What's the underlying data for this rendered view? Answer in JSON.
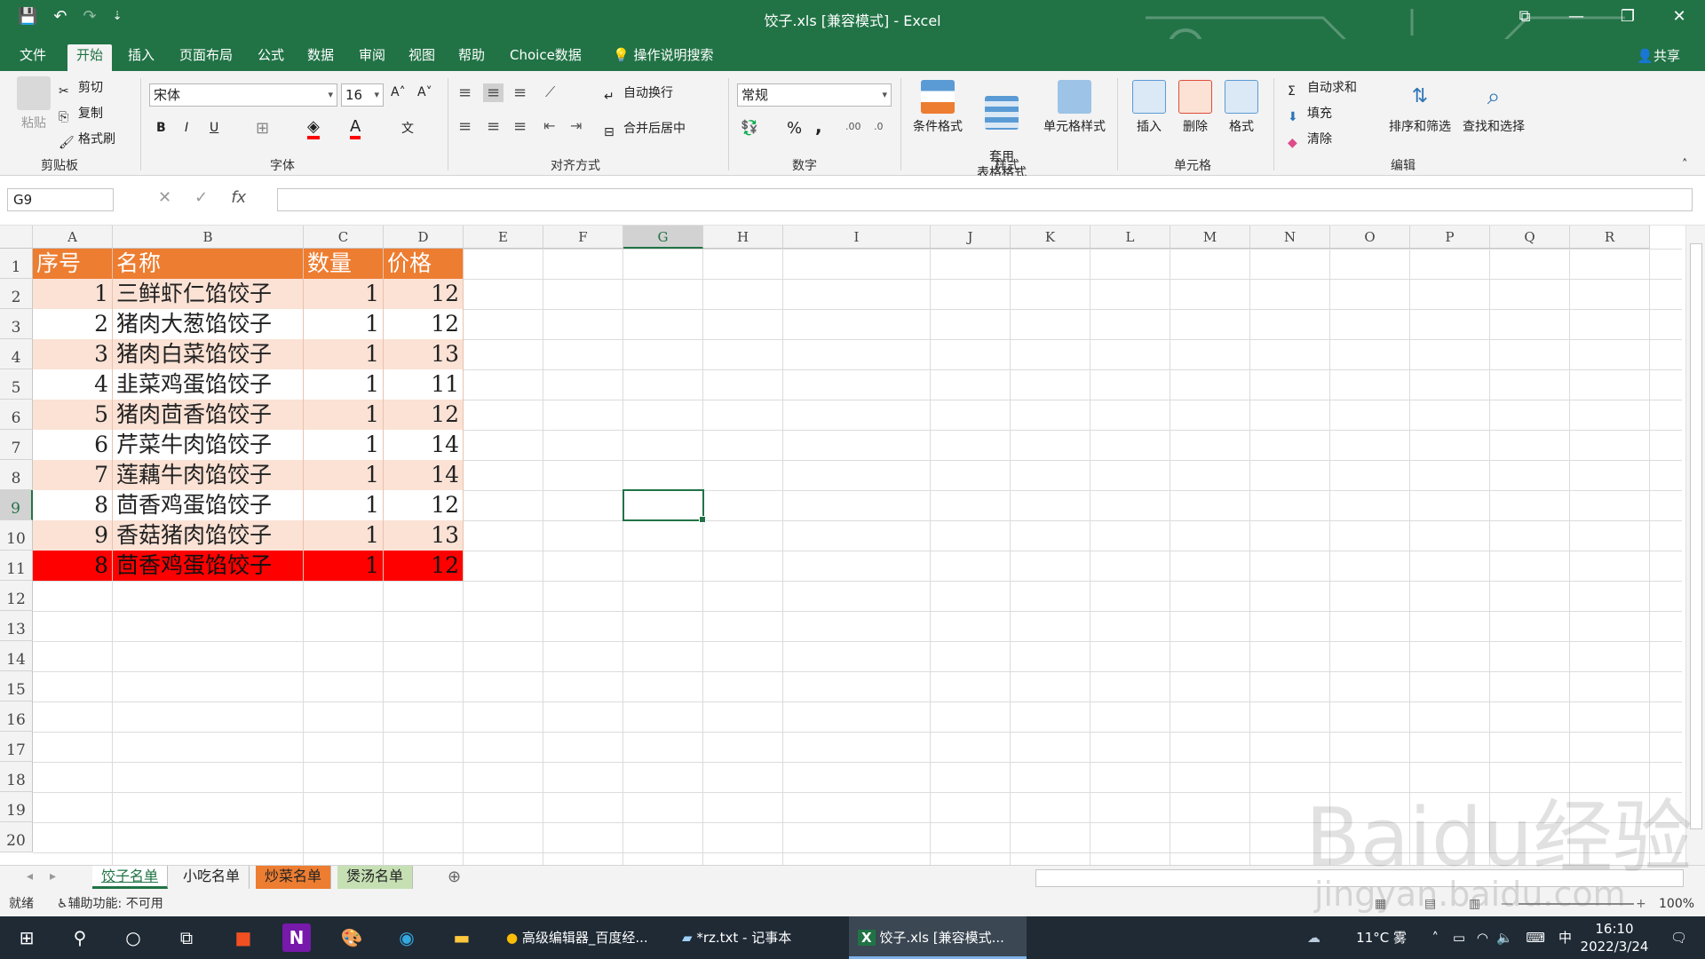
{
  "title": "饺子.xls [兼容模式] - Excel",
  "qat": {
    "save": "💾",
    "undo": "↶",
    "redo": "↷",
    "more": "⇣"
  },
  "tabs": [
    "文件",
    "开始",
    "插入",
    "页面布局",
    "公式",
    "数据",
    "审阅",
    "视图",
    "帮助",
    "Choice数据",
    "操作说明搜索"
  ],
  "share": "共享",
  "ribbon": {
    "clipboard": {
      "paste": "粘贴",
      "cut": "剪切",
      "copy": "复制",
      "format_painter": "格式刷",
      "label": "剪贴板"
    },
    "font": {
      "name": "宋体",
      "size": "16",
      "bold": "B",
      "italic": "I",
      "underline": "U",
      "label": "字体",
      "grow": "A˄",
      "shrink": "A˅"
    },
    "align": {
      "wrap": "自动换行",
      "merge": "合并后居中",
      "label": "对齐方式"
    },
    "number": {
      "format": "常规",
      "percent": "%",
      "comma": ",",
      "label": "数字"
    },
    "styles": {
      "cond": "条件格式",
      "table": "套用\n表格格式",
      "cell": "单元格样式",
      "label": "样式"
    },
    "cells": {
      "insert": "插入",
      "delete": "删除",
      "format": "格式",
      "label": "单元格"
    },
    "editing": {
      "autosum": "自动求和",
      "fill": "填充",
      "clear": "清除",
      "sort": "排序和筛选",
      "find": "查找和选择",
      "label": "编辑"
    }
  },
  "formula_bar": {
    "namebox": "G9",
    "fx": "fx",
    "formula": ""
  },
  "columns": [
    "A",
    "B",
    "C",
    "D",
    "E",
    "F",
    "G",
    "H",
    "I",
    "J",
    "K",
    "L",
    "M",
    "N",
    "O",
    "P",
    "Q",
    "R"
  ],
  "rows": [
    "1",
    "2",
    "3",
    "4",
    "5",
    "6",
    "7",
    "8",
    "9",
    "10",
    "11",
    "12",
    "13",
    "14",
    "15",
    "16",
    "17",
    "18",
    "19",
    "20"
  ],
  "table": {
    "headers": [
      "序号",
      "名称",
      "数量",
      "价格"
    ],
    "data": [
      [
        "1",
        "三鲜虾仁馅饺子",
        "1",
        "12"
      ],
      [
        "2",
        "猪肉大葱馅饺子",
        "1",
        "12"
      ],
      [
        "3",
        "猪肉白菜馅饺子",
        "1",
        "13"
      ],
      [
        "4",
        "韭菜鸡蛋馅饺子",
        "1",
        "11"
      ],
      [
        "5",
        "猪肉茴香馅饺子",
        "1",
        "12"
      ],
      [
        "6",
        "芹菜牛肉馅饺子",
        "1",
        "14"
      ],
      [
        "7",
        "莲藕牛肉馅饺子",
        "1",
        "14"
      ],
      [
        "8",
        "茴香鸡蛋馅饺子",
        "1",
        "12"
      ],
      [
        "9",
        "香菇猪肉馅饺子",
        "1",
        "13"
      ],
      [
        "8",
        "茴香鸡蛋馅饺子",
        "1",
        "12"
      ]
    ]
  },
  "sheets": [
    "饺子名单",
    "小吃名单",
    "炒菜名单",
    "煲汤名单"
  ],
  "status": {
    "ready": "就绪",
    "accessibility": "辅助功能: 不可用",
    "zoom": "100%"
  },
  "taskbar": {
    "apps": [
      "高级编辑器_百度经...",
      "*rz.txt - 记事本",
      "饺子.xls [兼容模式..."
    ],
    "weather": "11°C 雾",
    "ime": "中",
    "time": "16:10",
    "date": "2022/3/24"
  },
  "watermark": {
    "brand": "Baidu经验",
    "url": "jingyan.baidu.com"
  },
  "colors": {
    "excel_green": "#217346",
    "header_orange": "#ed7d31",
    "band_peach": "#fbe2d5",
    "highlight_red": "#ff0000"
  }
}
